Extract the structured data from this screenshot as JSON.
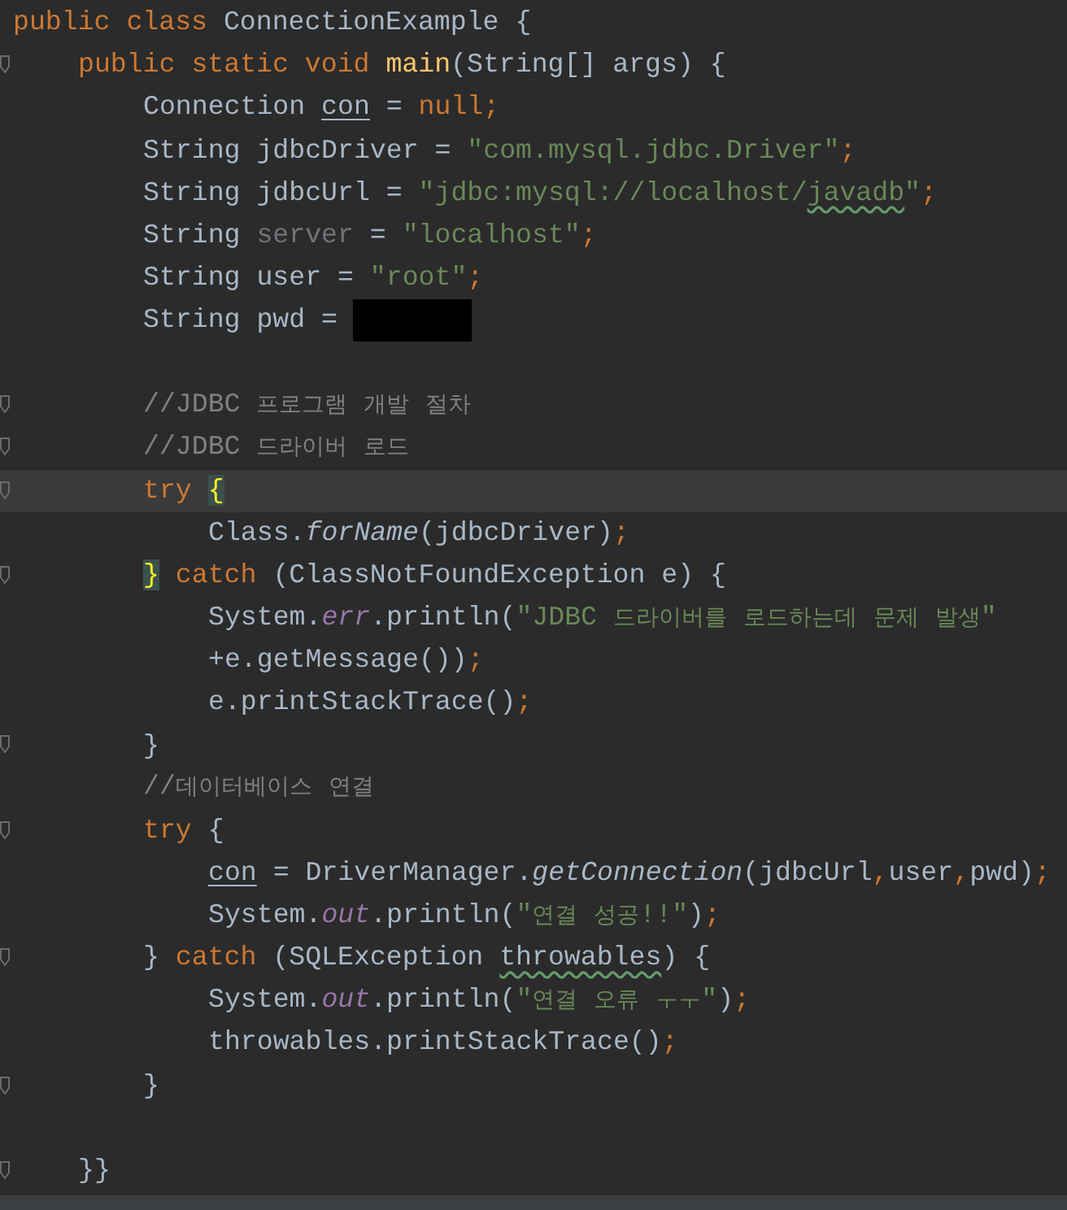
{
  "editor": {
    "lines": [
      {
        "fold_mark": false,
        "current": false,
        "tokens": [
          {
            "kind": "kw",
            "text": "public class "
          },
          {
            "kind": "plain",
            "text": "ConnectionExample {"
          }
        ],
        "children": [
          {
            "fold_mark": true,
            "current": false,
            "tokens": [
              {
                "kind": "kw",
                "text": "public static void "
              },
              {
                "kind": "decl",
                "text": "main"
              },
              {
                "kind": "plain",
                "text": "(String[] args) {"
              }
            ],
            "children": [
              {
                "fold_mark": false,
                "current": false,
                "tokens": [
                  {
                    "kind": "plain",
                    "text": "Connection "
                  },
                  {
                    "kind": "underline",
                    "text": "con"
                  },
                  {
                    "kind": "plain",
                    "text": " = "
                  },
                  {
                    "kind": "kw",
                    "text": "null;"
                  }
                ]
              },
              {
                "fold_mark": false,
                "current": false,
                "tokens": [
                  {
                    "kind": "plain",
                    "text": "String jdbcDriver = "
                  },
                  {
                    "kind": "str",
                    "text": "\"com.mysql.jdbc.Driver\""
                  },
                  {
                    "kind": "kw",
                    "text": ";"
                  }
                ]
              },
              {
                "fold_mark": false,
                "current": false,
                "tokens": [
                  {
                    "kind": "plain",
                    "text": "String jdbcUrl = "
                  },
                  {
                    "kind": "str",
                    "text": "\"jdbc:mysql://localhost/"
                  },
                  {
                    "kind": "str-typo",
                    "text": "javadb"
                  },
                  {
                    "kind": "str",
                    "text": "\""
                  },
                  {
                    "kind": "kw",
                    "text": ";"
                  }
                ]
              },
              {
                "fold_mark": false,
                "current": false,
                "tokens": [
                  {
                    "kind": "plain",
                    "text": "String "
                  },
                  {
                    "kind": "unused",
                    "text": "server"
                  },
                  {
                    "kind": "plain",
                    "text": " = "
                  },
                  {
                    "kind": "str",
                    "text": "\"localhost\""
                  },
                  {
                    "kind": "kw",
                    "text": ";"
                  }
                ]
              },
              {
                "fold_mark": false,
                "current": false,
                "tokens": [
                  {
                    "kind": "plain",
                    "text": "String user = "
                  },
                  {
                    "kind": "str",
                    "text": "\"root\""
                  },
                  {
                    "kind": "kw",
                    "text": ";"
                  }
                ]
              },
              {
                "fold_mark": false,
                "current": false,
                "redacted": true,
                "tokens": [
                  {
                    "kind": "plain",
                    "text": "String pwd = "
                  }
                ]
              },
              {
                "fold_mark": false,
                "current": false
              },
              {
                "fold_mark": true,
                "current": false,
                "tokens": [
                  {
                    "kind": "comment",
                    "text": "//JDBC 프로그램 개발 절차"
                  }
                ]
              },
              {
                "fold_mark": true,
                "current": false,
                "tokens": [
                  {
                    "kind": "comment",
                    "text": "//JDBC 드라이버 로드"
                  }
                ]
              },
              {
                "fold_mark": true,
                "current": true,
                "tokens": [
                  {
                    "kind": "kw",
                    "text": "try "
                  },
                  {
                    "kind": "brace",
                    "text": "{"
                  }
                ],
                "children": [
                  {
                    "fold_mark": false,
                    "current": false,
                    "tokens": [
                      {
                        "kind": "plain",
                        "text": "Class."
                      },
                      {
                        "kind": "static",
                        "text": "forName"
                      },
                      {
                        "kind": "plain",
                        "text": "(jdbcDriver)"
                      },
                      {
                        "kind": "kw",
                        "text": ";"
                      }
                    ]
                  }
                ]
              },
              {
                "fold_mark": true,
                "current": false,
                "tokens": [
                  {
                    "kind": "brace",
                    "text": "}"
                  },
                  {
                    "kind": "kw",
                    "text": " catch "
                  },
                  {
                    "kind": "plain",
                    "text": "(ClassNotFoundException e) {"
                  }
                ],
                "children": [
                  {
                    "fold_mark": false,
                    "current": false,
                    "tokens": [
                      {
                        "kind": "plain",
                        "text": "System."
                      },
                      {
                        "kind": "field",
                        "text": "err"
                      },
                      {
                        "kind": "plain",
                        "text": ".println("
                      },
                      {
                        "kind": "str",
                        "text": "\"JDBC 드라이버를 로드하는데 문제 발생\""
                      }
                    ]
                  },
                  {
                    "fold_mark": false,
                    "current": false,
                    "tokens": [
                      {
                        "kind": "plain",
                        "text": "+e.getMessage())"
                      },
                      {
                        "kind": "kw",
                        "text": ";"
                      }
                    ]
                  },
                  {
                    "fold_mark": false,
                    "current": false,
                    "tokens": [
                      {
                        "kind": "plain",
                        "text": "e.printStackTrace()"
                      },
                      {
                        "kind": "kw",
                        "text": ";"
                      }
                    ]
                  }
                ]
              },
              {
                "fold_mark": true,
                "current": false,
                "tokens": [
                  {
                    "kind": "plain",
                    "text": "}"
                  }
                ]
              },
              {
                "fold_mark": false,
                "current": false,
                "tokens": [
                  {
                    "kind": "comment",
                    "text": "//데이터베이스 연결"
                  }
                ]
              },
              {
                "fold_mark": true,
                "current": false,
                "tokens": [
                  {
                    "kind": "kw",
                    "text": "try "
                  },
                  {
                    "kind": "plain",
                    "text": "{"
                  }
                ],
                "children": [
                  {
                    "fold_mark": false,
                    "current": false,
                    "tokens": [
                      {
                        "kind": "underline",
                        "text": "con"
                      },
                      {
                        "kind": "plain",
                        "text": " = DriverManager."
                      },
                      {
                        "kind": "static",
                        "text": "getConnection"
                      },
                      {
                        "kind": "plain",
                        "text": "(jdbcUrl"
                      },
                      {
                        "kind": "kw",
                        "text": ","
                      },
                      {
                        "kind": "plain",
                        "text": "user"
                      },
                      {
                        "kind": "kw",
                        "text": ","
                      },
                      {
                        "kind": "plain",
                        "text": "pwd)"
                      },
                      {
                        "kind": "kw",
                        "text": ";"
                      }
                    ]
                  },
                  {
                    "fold_mark": false,
                    "current": false,
                    "tokens": [
                      {
                        "kind": "plain",
                        "text": "System."
                      },
                      {
                        "kind": "field",
                        "text": "out"
                      },
                      {
                        "kind": "plain",
                        "text": ".println("
                      },
                      {
                        "kind": "str",
                        "text": "\"연결 성공!!\""
                      },
                      {
                        "kind": "plain",
                        "text": ")"
                      },
                      {
                        "kind": "kw",
                        "text": ";"
                      }
                    ]
                  }
                ]
              },
              {
                "fold_mark": true,
                "current": false,
                "tokens": [
                  {
                    "kind": "plain",
                    "text": "} "
                  },
                  {
                    "kind": "kw",
                    "text": "catch "
                  },
                  {
                    "kind": "plain",
                    "text": "(SQLException "
                  },
                  {
                    "kind": "plain-typo",
                    "text": "throwables"
                  },
                  {
                    "kind": "plain",
                    "text": ") {"
                  }
                ],
                "children": [
                  {
                    "fold_mark": false,
                    "current": false,
                    "tokens": [
                      {
                        "kind": "plain",
                        "text": "System."
                      },
                      {
                        "kind": "field",
                        "text": "out"
                      },
                      {
                        "kind": "plain",
                        "text": ".println("
                      },
                      {
                        "kind": "str",
                        "text": "\"연결 오류 ㅜㅜ\""
                      },
                      {
                        "kind": "plain",
                        "text": ")"
                      },
                      {
                        "kind": "kw",
                        "text": ";"
                      }
                    ]
                  },
                  {
                    "fold_mark": false,
                    "current": false,
                    "tokens": [
                      {
                        "kind": "plain",
                        "text": "throwables.printStackTrace()"
                      },
                      {
                        "kind": "kw",
                        "text": ";"
                      }
                    ]
                  }
                ]
              },
              {
                "fold_mark": true,
                "current": false,
                "tokens": [
                  {
                    "kind": "plain",
                    "text": "}"
                  }
                ]
              },
              {
                "fold_mark": false,
                "current": false
              }
            ]
          },
          {
            "fold_mark": true,
            "current": false,
            "tokens": [
              {
                "kind": "plain",
                "text": "}}"
              }
            ]
          }
        ]
      }
    ]
  }
}
